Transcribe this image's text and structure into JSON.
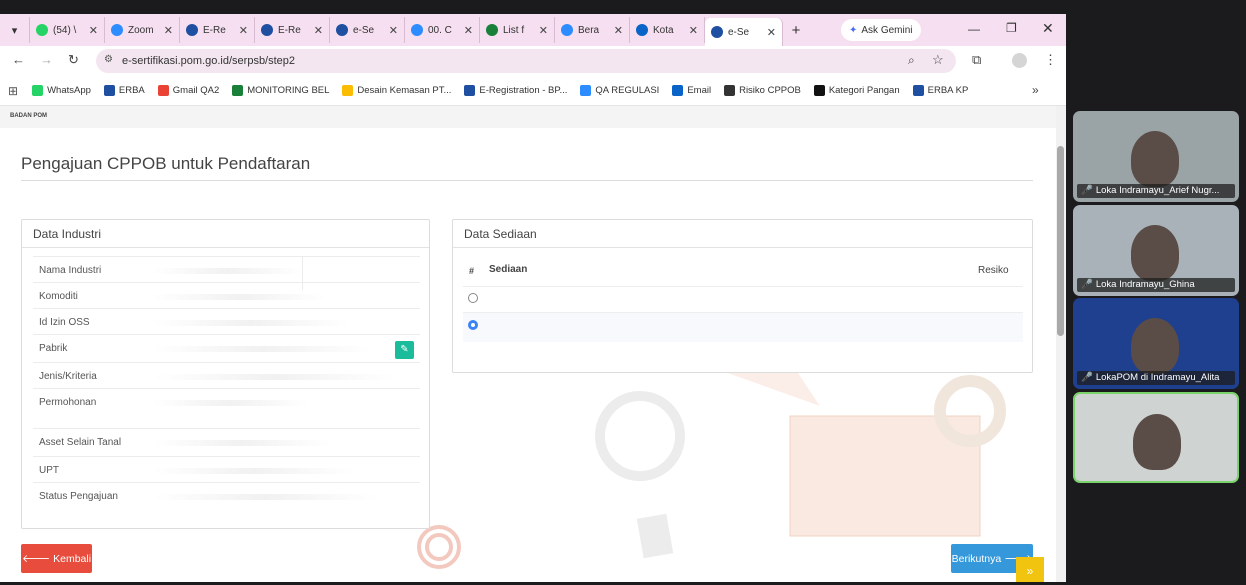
{
  "tabs": [
    {
      "label": "(54) \\",
      "color": "#25d366",
      "active": false
    },
    {
      "label": "Zoom",
      "color": "#2d8cff",
      "active": false
    },
    {
      "label": "E-Re",
      "color": "#1e4fa0",
      "active": false
    },
    {
      "label": "E-Re",
      "color": "#1e4fa0",
      "active": false
    },
    {
      "label": "e-Se",
      "color": "#1e4fa0",
      "active": false
    },
    {
      "label": "00. C",
      "color": "#2d8cff",
      "active": false
    },
    {
      "label": "List f",
      "color": "#188038",
      "active": false
    },
    {
      "label": "Bera",
      "color": "#2d8cff",
      "active": false
    },
    {
      "label": "Kota",
      "color": "#0a64c8",
      "active": false
    },
    {
      "label": "e-Se",
      "color": "#1e4fa0",
      "active": true
    }
  ],
  "ask_gemini": "Ask Gemini",
  "url": "e-sertifikasi.pom.go.id/serpsb/step2",
  "bookmarks": [
    "WhatsApp",
    "ERBA",
    "Gmail QA2",
    "MONITORING BEL",
    "Desain Kemasan PT...",
    "E-Registration - BP...",
    "QA REGULASI",
    "Email",
    "Risiko CPPOB",
    "Kategori Pangan",
    "ERBA KP"
  ],
  "logo_text": "BADAN POM",
  "page_title": "Pengajuan CPPOB untuk Pendaftaran",
  "industri": {
    "heading": "Data Industri",
    "fields": [
      "Nama Industri",
      "Komoditi",
      "Id Izin OSS",
      "Pabrik",
      "Jenis/Kriteria",
      "Permohonan",
      "Asset Selain Tanal",
      "UPT",
      "Status Pengajuan"
    ]
  },
  "sediaan": {
    "heading": "Data Sediaan",
    "col_num": "#",
    "col_sediaan": "Sediaan",
    "col_risiko": "Resiko"
  },
  "buttons": {
    "back": "Kembali",
    "next": "Berikutnya"
  },
  "participants": [
    "Loka Indramayu_Arief Nugr...",
    "Loka Indramayu_Ghina",
    "LokaPOM di Indramayu_Alita"
  ],
  "colors": {
    "accent": "#3498db",
    "danger": "#e74c3c",
    "edit": "#1abc9c",
    "tabbar": "#f5dff0"
  }
}
